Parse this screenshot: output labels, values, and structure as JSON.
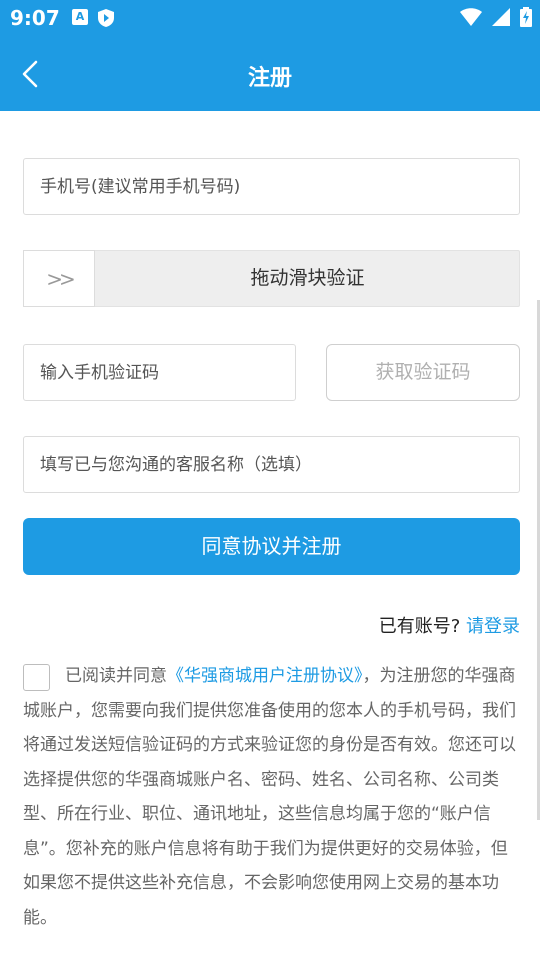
{
  "status_bar": {
    "time": "9:07",
    "icons": [
      "a-badge-icon",
      "shield-play-icon",
      "wifi-icon",
      "signal-icon",
      "battery-charging-icon"
    ],
    "badge_letter": "A"
  },
  "header": {
    "title": "注册",
    "back_icon": "chevron-left-icon",
    "color": "#1e9be3"
  },
  "form": {
    "phone_placeholder": "手机号(建议常用手机号码)",
    "slider_handle_text": ">>",
    "slider_label": "拖动滑块验证",
    "code_placeholder": "输入手机验证码",
    "get_code_label": "获取验证码",
    "service_placeholder": "填写已与您沟通的客服名称（选填）",
    "register_label": "同意协议并注册"
  },
  "login": {
    "prompt": "已有账号?",
    "link": "请登录"
  },
  "agreement": {
    "checked": false,
    "prefix": "已阅读并同意",
    "link": "《华强商城用户注册协议》",
    "body": "，为注册您的华强商城账户，您需要向我们提供您准备使用的您本人的手机号码，我们将通过发送短信验证码的方式来验证您的身份是否有效。您还可以选择提供您的华强商城账户名、密码、姓名、公司名称、公司类型、所在行业、职位、通讯地址，这些信息均属于您的“账户信息”。您补充的账户信息将有助于我们为提供更好的交易体验，但如果您不提供这些补充信息，不会影响您使用网上交易的基本功能。"
  }
}
